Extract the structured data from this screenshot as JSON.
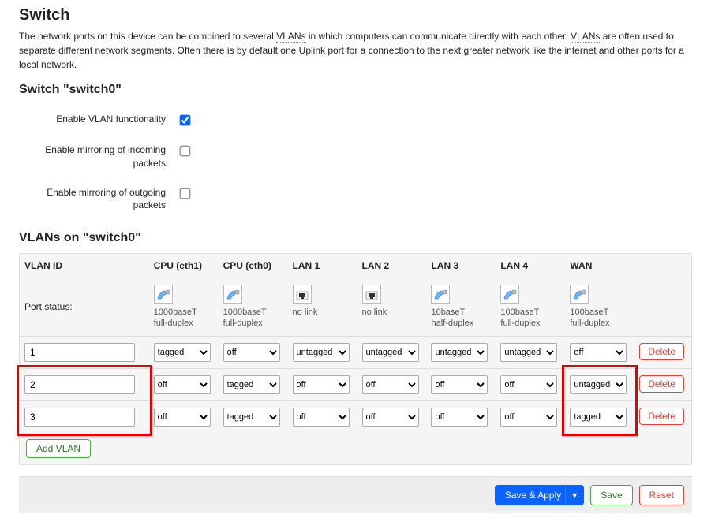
{
  "page": {
    "title": "Switch",
    "intro_pre": "The network ports on this device can be combined to several ",
    "intro_vlans1": "VLANs",
    "intro_mid": " in which computers can communicate directly with each other. ",
    "intro_vlans2": "VLANs",
    "intro_post": " are often used to separate different network segments. Often there is by default one Uplink port for a connection to the next greater network like the internet and other ports for a local network."
  },
  "switch_section": {
    "heading": "Switch \"switch0\"",
    "rows": [
      {
        "label": "Enable VLAN functionality",
        "checked": true
      },
      {
        "label": "Enable mirroring of incoming packets",
        "checked": false
      },
      {
        "label": "Enable mirroring of outgoing packets",
        "checked": false
      }
    ]
  },
  "vlan_section": {
    "heading": "VLANs on \"switch0\"",
    "headers": [
      "VLAN ID",
      "CPU (eth1)",
      "CPU (eth0)",
      "LAN 1",
      "LAN 2",
      "LAN 3",
      "LAN 4",
      "WAN",
      ""
    ],
    "status_label": "Port status:",
    "ports": [
      {
        "icon": "cpu",
        "line1": "1000baseT",
        "line2": "full-duplex"
      },
      {
        "icon": "cpu",
        "line1": "1000baseT",
        "line2": "full-duplex"
      },
      {
        "icon": "port",
        "line1": "no link",
        "line2": ""
      },
      {
        "icon": "port",
        "line1": "no link",
        "line2": ""
      },
      {
        "icon": "cpu",
        "line1": "10baseT",
        "line2": "half-duplex"
      },
      {
        "icon": "cpu",
        "line1": "100baseT",
        "line2": "full-duplex"
      },
      {
        "icon": "cpu",
        "line1": "100baseT",
        "line2": "full-duplex"
      }
    ],
    "options": [
      "off",
      "tagged",
      "untagged"
    ],
    "rows": [
      {
        "id": "1",
        "vals": [
          "tagged",
          "off",
          "untagged",
          "untagged",
          "untagged",
          "untagged",
          "off"
        ]
      },
      {
        "id": "2",
        "vals": [
          "off",
          "tagged",
          "off",
          "off",
          "off",
          "off",
          "untagged"
        ]
      },
      {
        "id": "3",
        "vals": [
          "off",
          "tagged",
          "off",
          "off",
          "off",
          "off",
          "tagged"
        ]
      }
    ],
    "delete_label": "Delete",
    "add_label": "Add VLAN"
  },
  "footer": {
    "save_apply": "Save & Apply",
    "save": "Save",
    "reset": "Reset"
  }
}
